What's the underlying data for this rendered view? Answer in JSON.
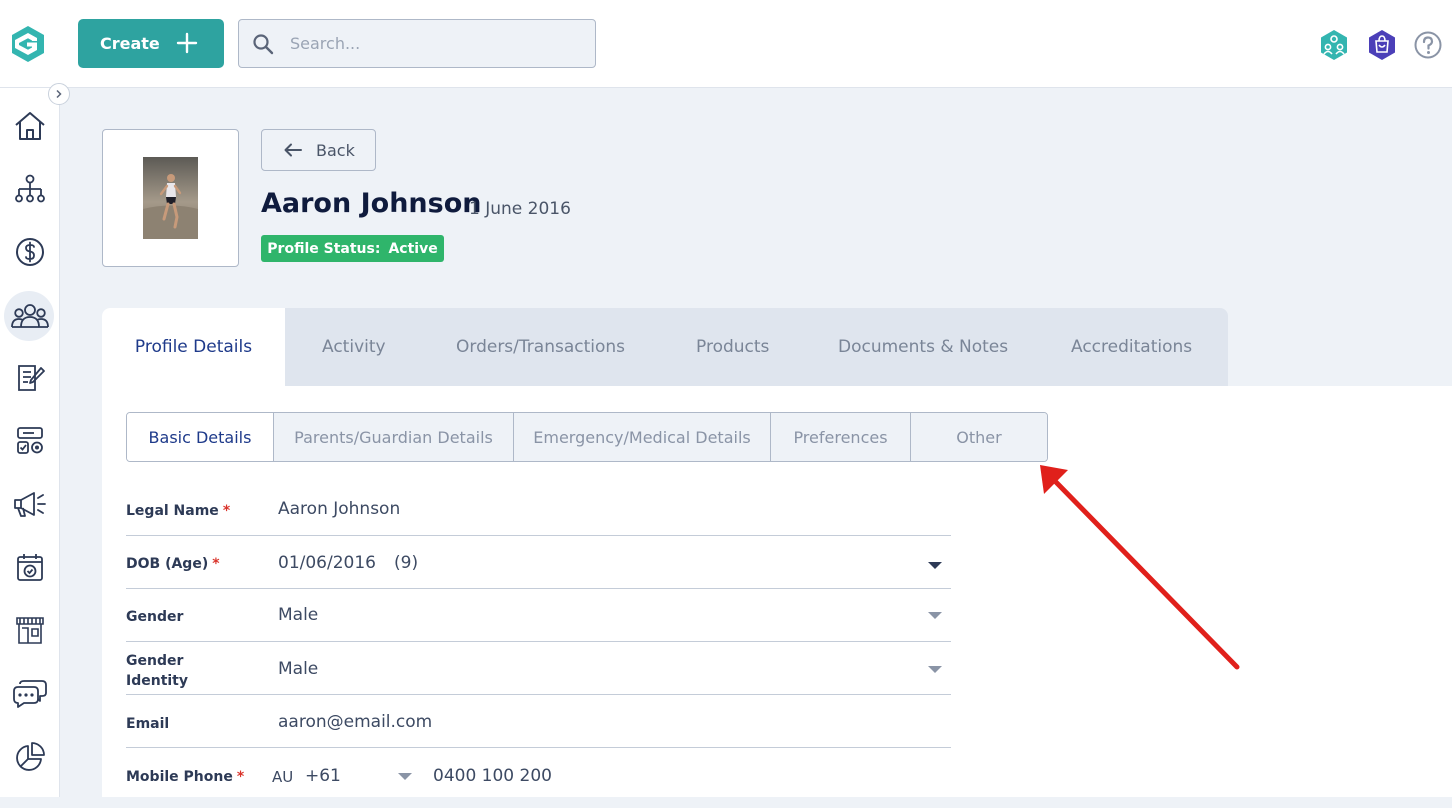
{
  "header": {
    "create_label": "Create",
    "search_placeholder": "Search...",
    "icons": [
      "team-icon",
      "shop-icon",
      "help-icon"
    ]
  },
  "sidebar": {
    "items": [
      "home-icon",
      "org-chart-icon",
      "dollar-icon",
      "users-icon",
      "form-icon",
      "competition-icon",
      "megaphone-icon",
      "calendar-check-icon",
      "shop-front-icon",
      "chat-icon",
      "pie-chart-icon"
    ],
    "active": "users-icon"
  },
  "profile": {
    "back_label": "Back",
    "name": "Aaron Johnson",
    "date": "1 June 2016",
    "status_label": "Profile Status:",
    "status_value": "Active"
  },
  "tabs": [
    "Profile Details",
    "Activity",
    "Orders/Transactions",
    "Products",
    "Documents & Notes",
    "Accreditations"
  ],
  "subtabs": [
    "Basic Details",
    "Parents/Guardian Details",
    "Emergency/Medical Details",
    "Preferences",
    "Other"
  ],
  "form": {
    "legal_name": {
      "label": "Legal Name",
      "required": "*",
      "value": "Aaron Johnson"
    },
    "dob": {
      "label": "DOB (Age)",
      "required": "*",
      "value": "01/06/2016",
      "age": "(9)"
    },
    "gender": {
      "label": "Gender",
      "value": "Male"
    },
    "gender_identity": {
      "label": "Gender Identity",
      "value": "Male"
    },
    "email": {
      "label": "Email",
      "value": "aaron@email.com"
    },
    "mobile": {
      "label": "Mobile Phone",
      "required": "*",
      "country": "AU",
      "code": "+61",
      "number": "0400 100 200"
    }
  },
  "colors": {
    "brand": "#2ea3a0",
    "status_active": "#2fb56b",
    "active_tab_text": "#1e3a8a",
    "annotation_arrow": "#e0201b"
  }
}
